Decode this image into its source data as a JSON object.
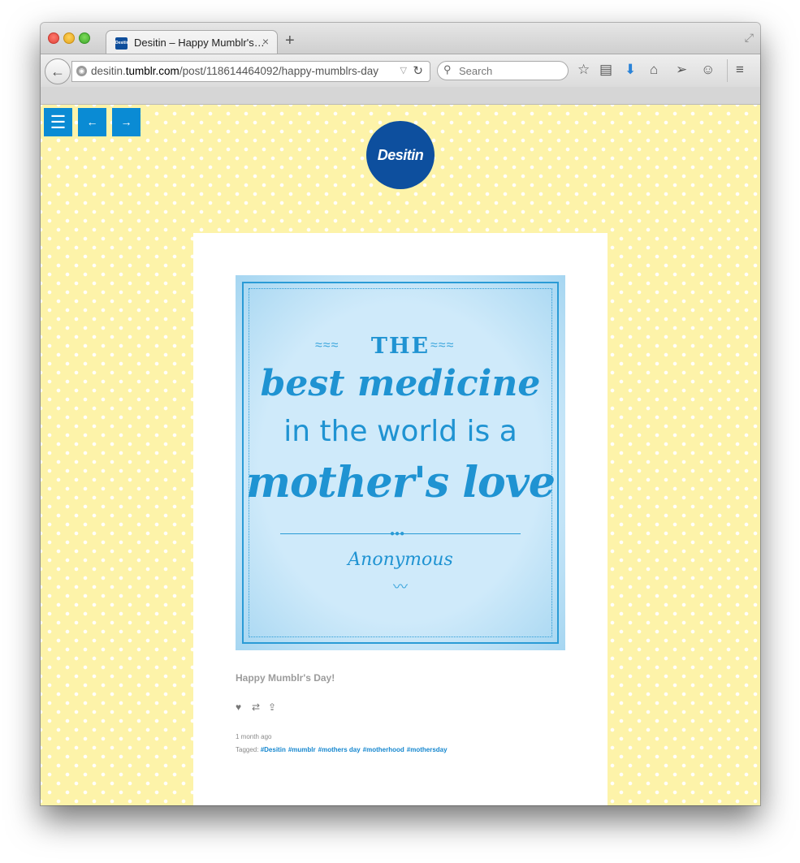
{
  "browser": {
    "tab_title": "Desitin – Happy Mumblr's…",
    "favicon_text": "Desitin",
    "tab_close": "×",
    "new_tab": "+",
    "url_prefix": "desitin.",
    "url_host": "tumblr.com",
    "url_path": "/post/118614464092/happy-mumblrs-day",
    "search_placeholder": "Search",
    "icons": [
      "back-arrow-icon",
      "globe-icon",
      "dropdown-icon",
      "reload-icon",
      "search-icon",
      "star-icon",
      "reading-list-icon",
      "download-icon",
      "home-icon",
      "send-icon",
      "chat-icon",
      "menu-icon"
    ]
  },
  "page": {
    "menu_label": "☰",
    "prev_label": "←",
    "next_label": "→",
    "logo_text": "Desitin",
    "poster": {
      "line1": "THE",
      "line2": "best medicine",
      "line3": "in the world is a",
      "line4": "mother's love",
      "attribution": "Anonymous"
    },
    "caption": "Happy Mumblr's Day!",
    "time_ago": "1 month ago",
    "tagged_label": "Tagged:",
    "tags": [
      "#Desitin",
      "#mumblr",
      "#mothers day",
      "#motherhood",
      "#mothersday"
    ]
  },
  "colors": {
    "accent_blue": "#0a8bd4",
    "logo_blue": "#0d4f9e",
    "page_yellow": "#fdf3a9",
    "poster_blue": "#bfe3f7",
    "tag_blue": "#1687cf"
  }
}
